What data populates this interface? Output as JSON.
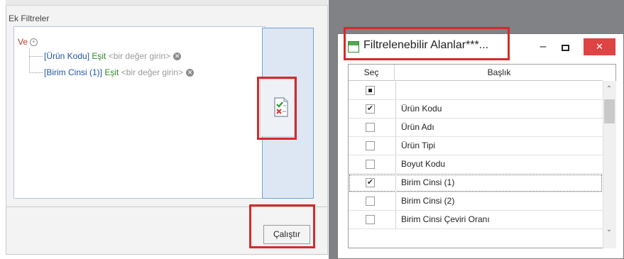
{
  "left_panel": {
    "section_title": "Ek Filtreler",
    "root_operator": "Ve",
    "conditions": [
      {
        "field": "[Ürün Kodu]",
        "operator": "Eşit",
        "placeholder": "<bir değer girin>"
      },
      {
        "field": "[Birim Cinsi (1)]",
        "operator": "Eşit",
        "placeholder": "<bir değer girin>"
      }
    ],
    "apply_icon": "checklist-edit-icon",
    "run_button": "Çalıştır"
  },
  "dialog": {
    "title": "Filtrelenebilir Alanlar***...",
    "window_buttons": {
      "minimize": "–",
      "close": "✕"
    },
    "columns": {
      "select": "Seç",
      "title": "Başlık"
    },
    "rows": [
      {
        "label": "Ürün Kodu",
        "checked": true
      },
      {
        "label": "Ürün Adı",
        "checked": false
      },
      {
        "label": "Ürün Tipi",
        "checked": false
      },
      {
        "label": "Boyut Kodu",
        "checked": false
      },
      {
        "label": "Birim Cinsi (1)",
        "checked": true
      },
      {
        "label": "Birim Cinsi (2)",
        "checked": false
      },
      {
        "label": "Birim Cinsi Çeviri Oranı",
        "checked": false
      }
    ]
  },
  "colors": {
    "highlight_red": "#d62a2a",
    "close_red": "#e04343",
    "operator_red": "#c0392b",
    "field_blue": "#2255a8",
    "equals_green": "#2e8b2e"
  }
}
